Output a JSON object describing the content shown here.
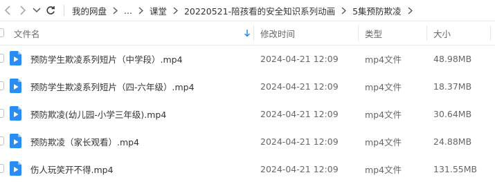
{
  "breadcrumb": {
    "items": [
      "我的网盘",
      "...",
      "课堂",
      "20220521-陪孩看的安全知识系列动画",
      "5集预防欺凌"
    ]
  },
  "table": {
    "columns": {
      "name": "文件名",
      "modified": "修改时间",
      "type": "类型",
      "size": "大小"
    },
    "rows": [
      {
        "name": "预防学生欺凌系列短片（中学段）.mp4",
        "modified": "2024-04-21 12:09",
        "type": "mp4文件",
        "size": "48.98MB"
      },
      {
        "name": "预防学生欺凌系列短片（四-六年级）.mp4",
        "modified": "2024-04-21 12:09",
        "type": "mp4文件",
        "size": "18.37MB"
      },
      {
        "name": "预防欺凌(幼儿园-小学三年级).mp4",
        "modified": "2024-04-21 12:09",
        "type": "mp4文件",
        "size": "30.64MB"
      },
      {
        "name": "预防欺凌（家长观看）.mp4",
        "modified": "2024-04-21 12:09",
        "type": "mp4文件",
        "size": "24.88MB"
      },
      {
        "name": "伤人玩笑开不得.mp4",
        "modified": "2024-04-21 12:09",
        "type": "mp4文件",
        "size": "131.55MB"
      }
    ]
  },
  "colors": {
    "video_icon": "#2a8cf5",
    "sort_arrow": "#1e88ff"
  },
  "icons": {
    "back": "chevron-left-icon",
    "forward": "chevron-right-icon",
    "dropdown": "chevron-down-icon",
    "refresh": "refresh-icon",
    "sort": "arrow-down-icon",
    "file": "video-file-icon"
  }
}
